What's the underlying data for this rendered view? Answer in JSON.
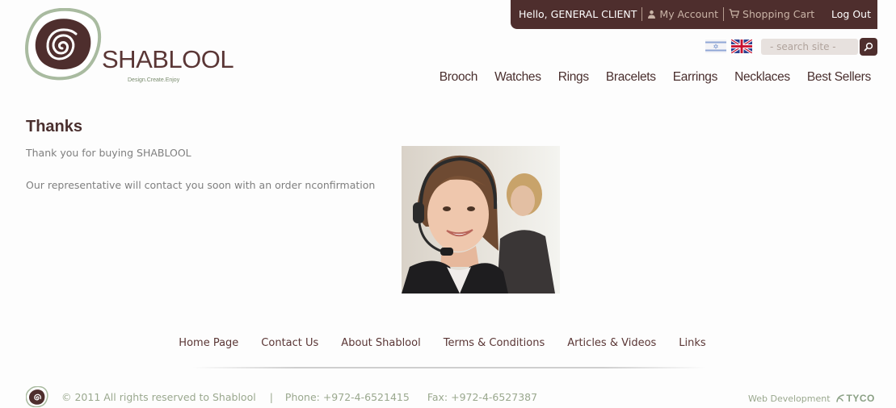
{
  "header": {
    "greeting": "Hello, GENERAL CLIENT",
    "my_account": "My Account",
    "shopping_cart": "Shopping Cart",
    "log_out": "Log Out",
    "search_placeholder": "- search site -",
    "icons": [
      "user-icon",
      "cart-icon",
      "search-icon",
      "israel-flag-icon",
      "uk-flag-icon"
    ]
  },
  "logo": {
    "brand": "SHABLOOL",
    "tagline": "Design.Create.Enjoy"
  },
  "nav": {
    "items": [
      "Brooch",
      "Watches",
      "Rings",
      "Bracelets",
      "Earrings",
      "Necklaces",
      "Best Sellers"
    ]
  },
  "content": {
    "title": "Thanks",
    "thanks_line": "Thank you for buying SHABLOOL",
    "rep_line": "Our representative will contact you soon with an order nconfirmation"
  },
  "footer": {
    "links": [
      "Home Page",
      "Contact Us",
      "About Shablool",
      "Terms & Conditions",
      "Articles & Videos",
      "Links"
    ],
    "copyright": "© 2011 All rights reserved to Shablool",
    "separator": "|",
    "phone": "Phone: +972-4-6521415",
    "fax": "Fax: +972-4-6527387",
    "webdev": "Web Development",
    "webdev_brand": "TYCO"
  },
  "colors": {
    "brand_brown": "#4e2e2d",
    "sage": "#9aa88e",
    "text_gray": "#7f7f7f"
  }
}
